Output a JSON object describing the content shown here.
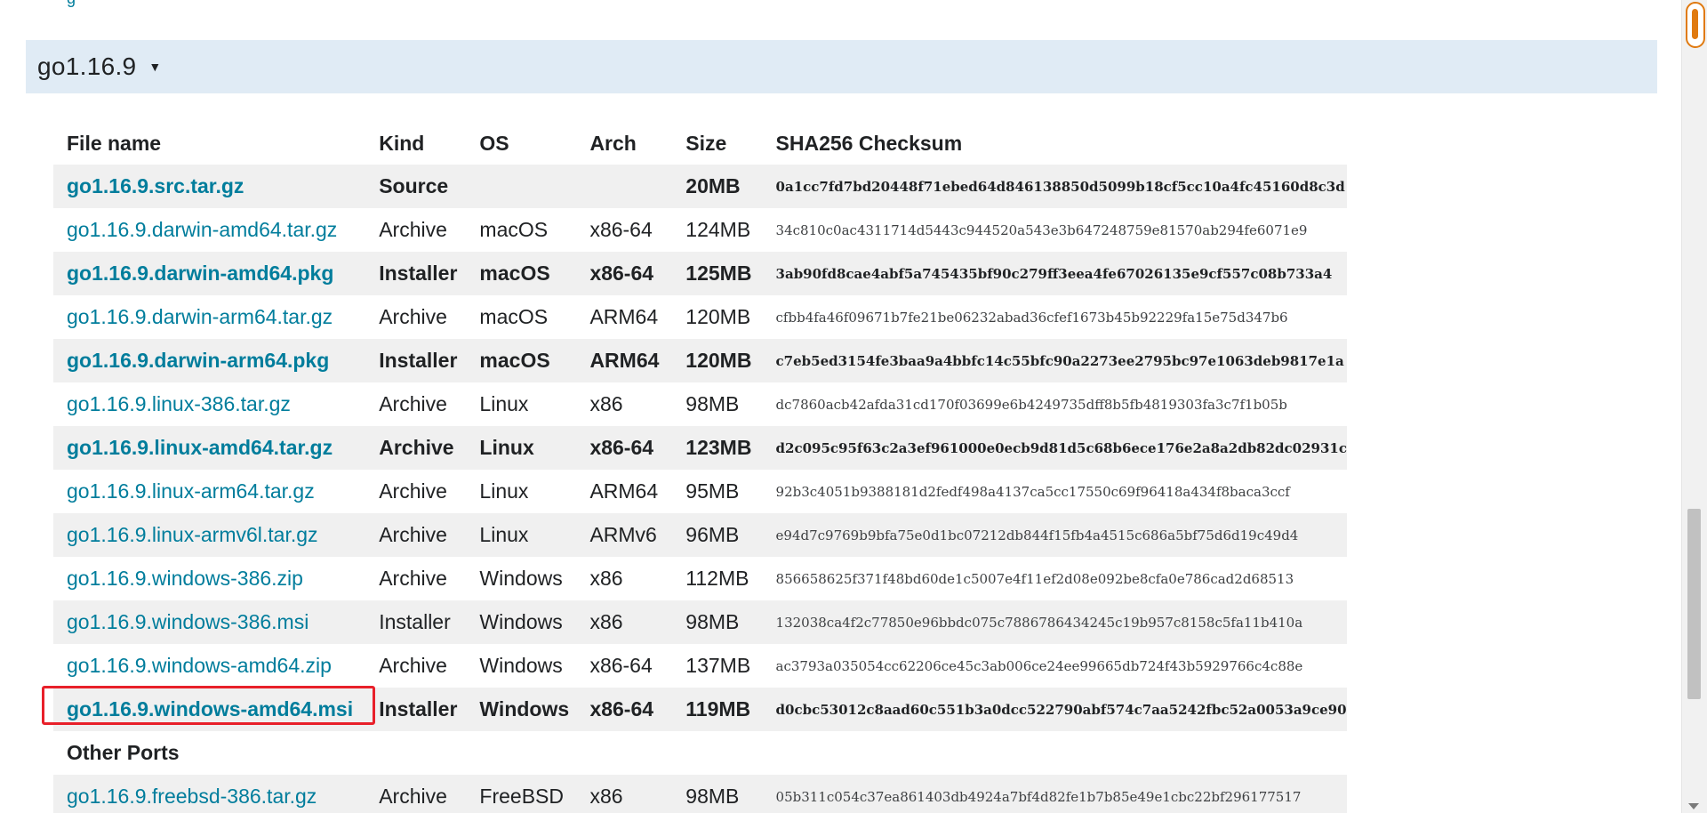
{
  "release": {
    "version": "go1.16.9",
    "toggle_icon": "triangle-down-icon"
  },
  "table": {
    "headers": {
      "file_name": "File name",
      "kind": "Kind",
      "os": "OS",
      "arch": "Arch",
      "size": "Size",
      "checksum": "SHA256 Checksum"
    },
    "rows": [
      {
        "file": "go1.16.9.src.tar.gz",
        "kind": "Source",
        "os": "",
        "arch": "",
        "size": "20MB",
        "checksum": "0a1cc7fd7bd20448f71ebed64d846138850d5099b18cf5cc10a4fc45160d8c3d",
        "featured": true
      },
      {
        "file": "go1.16.9.darwin-amd64.tar.gz",
        "kind": "Archive",
        "os": "macOS",
        "arch": "x86-64",
        "size": "124MB",
        "checksum": "34c810c0ac4311714d5443c944520a543e3b647248759e81570ab294fe6071e9",
        "featured": false
      },
      {
        "file": "go1.16.9.darwin-amd64.pkg",
        "kind": "Installer",
        "os": "macOS",
        "arch": "x86-64",
        "size": "125MB",
        "checksum": "3ab90fd8cae4abf5a745435bf90c279ff3eea4fe67026135e9cf557c08b733a4",
        "featured": true
      },
      {
        "file": "go1.16.9.darwin-arm64.tar.gz",
        "kind": "Archive",
        "os": "macOS",
        "arch": "ARM64",
        "size": "120MB",
        "checksum": "cfbb4fa46f09671b7fe21be06232abad36cfef1673b45b92229fa15e75d347b6",
        "featured": false
      },
      {
        "file": "go1.16.9.darwin-arm64.pkg",
        "kind": "Installer",
        "os": "macOS",
        "arch": "ARM64",
        "size": "120MB",
        "checksum": "c7eb5ed3154fe3baa9a4bbfc14c55bfc90a2273ee2795bc97e1063deb9817e1a",
        "featured": true
      },
      {
        "file": "go1.16.9.linux-386.tar.gz",
        "kind": "Archive",
        "os": "Linux",
        "arch": "x86",
        "size": "98MB",
        "checksum": "dc7860acb42afda31cd170f03699e6b4249735dff8b5fb4819303fa3c7f1b05b",
        "featured": false
      },
      {
        "file": "go1.16.9.linux-amd64.tar.gz",
        "kind": "Archive",
        "os": "Linux",
        "arch": "x86-64",
        "size": "123MB",
        "checksum": "d2c095c95f63c2a3ef961000e0ecb9d81d5c68b6ece176e2a8a2db82dc02931c",
        "featured": true
      },
      {
        "file": "go1.16.9.linux-arm64.tar.gz",
        "kind": "Archive",
        "os": "Linux",
        "arch": "ARM64",
        "size": "95MB",
        "checksum": "92b3c4051b9388181d2fedf498a4137ca5cc17550c69f96418a434f8baca3ccf",
        "featured": false
      },
      {
        "file": "go1.16.9.linux-armv6l.tar.gz",
        "kind": "Archive",
        "os": "Linux",
        "arch": "ARMv6",
        "size": "96MB",
        "checksum": "e94d7c9769b9bfa75e0d1bc07212db844f15fb4a4515c686a5bf75d6d19c49d4",
        "featured": false
      },
      {
        "file": "go1.16.9.windows-386.zip",
        "kind": "Archive",
        "os": "Windows",
        "arch": "x86",
        "size": "112MB",
        "checksum": "856658625f371f48bd60de1c5007e4f11ef2d08e092be8cfa0e786cad2d68513",
        "featured": false
      },
      {
        "file": "go1.16.9.windows-386.msi",
        "kind": "Installer",
        "os": "Windows",
        "arch": "x86",
        "size": "98MB",
        "checksum": "132038ca4f2c77850e96bbdc075c7886786434245c19b957c8158c5fa11b410a",
        "featured": false
      },
      {
        "file": "go1.16.9.windows-amd64.zip",
        "kind": "Archive",
        "os": "Windows",
        "arch": "x86-64",
        "size": "137MB",
        "checksum": "ac3793a035054cc62206ce45c3ab006ce24ee99665db724f43b5929766c4c88e",
        "featured": false
      },
      {
        "file": "go1.16.9.windows-amd64.msi",
        "kind": "Installer",
        "os": "Windows",
        "arch": "x86-64",
        "size": "119MB",
        "checksum": "d0cbc53012c8aad60c551b3a0dcc522790abf574c7aa5242fbc52a0053a9ce90",
        "featured": true
      }
    ],
    "other_ports_label": "Other Ports",
    "other_rows": [
      {
        "file": "go1.16.9.freebsd-386.tar.gz",
        "kind": "Archive",
        "os": "FreeBSD",
        "arch": "x86",
        "size": "98MB",
        "checksum": "05b311c054c37ea861403db4924a7bf4d82fe1b7b85e49e1cbc22bf296177517",
        "featured": false
      }
    ]
  },
  "colors": {
    "link": "#007d9c",
    "header_band": "#e0ebf5",
    "row_stripe": "#f0f0f0",
    "selection_outline": "#e8202a"
  }
}
